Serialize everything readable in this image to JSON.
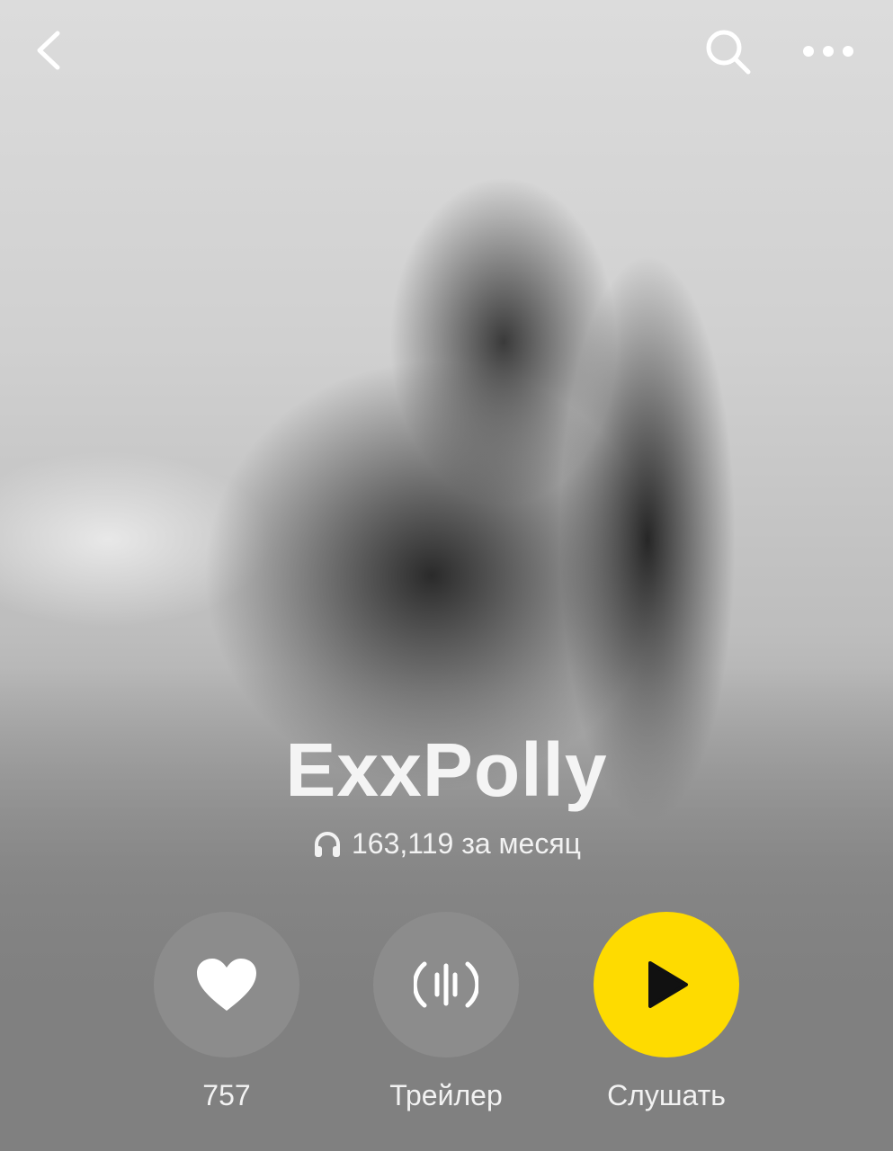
{
  "header": {
    "back_icon": "chevron-left-icon",
    "search_icon": "search-icon",
    "more_icon": "more-horizontal-icon"
  },
  "artist": {
    "name": "ExxPolly",
    "listeners_icon": "headphones-icon",
    "listeners_text": "163,119 за месяц"
  },
  "actions": {
    "like": {
      "icon": "heart-icon",
      "label": "757"
    },
    "trailer": {
      "icon": "waveform-icon",
      "label": "Трейлер"
    },
    "play": {
      "icon": "play-icon",
      "label": "Слушать"
    }
  },
  "colors": {
    "accent": "#fedb00",
    "background": "#808080",
    "text": "#f2f2f2"
  }
}
